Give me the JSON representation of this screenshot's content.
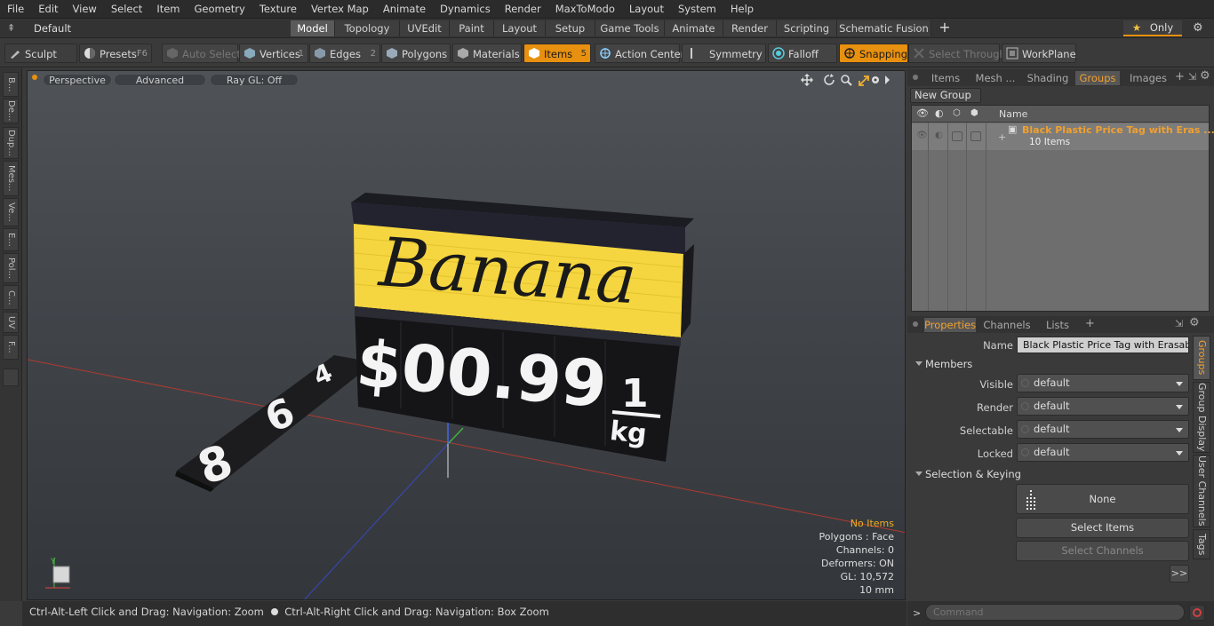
{
  "menu": [
    "File",
    "Edit",
    "View",
    "Select",
    "Item",
    "Geometry",
    "Texture",
    "Vertex Map",
    "Animate",
    "Dynamics",
    "Render",
    "MaxToModo",
    "Layout",
    "System",
    "Help"
  ],
  "layouts": {
    "current": "Default Layouts",
    "tabs": [
      "Model",
      "Topology",
      "UVEdit",
      "Paint",
      "Layout",
      "Setup",
      "Game Tools",
      "Animate",
      "Render",
      "Scripting",
      "Schematic Fusion"
    ],
    "active": "Model",
    "add": "+",
    "only_label": "Only",
    "star": "★"
  },
  "toolbar": {
    "sculpt": "Sculpt",
    "presets": "Presets",
    "presets_key": "F6",
    "auto_select": "Auto Select",
    "vertices": "Vertices",
    "vertices_count": "1",
    "edges": "Edges",
    "edges_count": "2",
    "polygons": "Polygons",
    "materials": "Materials",
    "items": "Items",
    "items_count": "5",
    "action_center": "Action Center",
    "symmetry": "Symmetry",
    "falloff": "Falloff",
    "snapping": "Snapping",
    "select_through": "Select Through",
    "workplane": "WorkPlane"
  },
  "left_tabs": [
    "B...",
    "De...",
    "Dup...",
    "Mes...",
    "Ve...",
    "E...",
    "Pol...",
    "C...",
    "UV",
    "F..."
  ],
  "viewport": {
    "perspective": "Perspective",
    "advanced": "Advanced",
    "raygl": "Ray GL: Off",
    "sign_title": "Banana",
    "sign_price": "$00.99",
    "sign_unit_top": "1",
    "sign_unit_bottom": "kg",
    "strip_digits": [
      "8",
      "6",
      "4"
    ],
    "info": {
      "no_items": "No Items",
      "polygons": "Polygons : Face",
      "channels": "Channels: 0",
      "deformers": "Deformers: ON",
      "gl": "GL: 10,572",
      "size": "10 mm"
    }
  },
  "status": {
    "left": "Ctrl-Alt-Left Click and Drag: Navigation: Zoom",
    "right": "Ctrl-Alt-Right Click and Drag: Navigation: Box Zoom"
  },
  "top_panel": {
    "tabs": [
      "Items",
      "Mesh ...",
      "Shading",
      "Groups",
      "Images"
    ],
    "active": "Groups",
    "new_group": "New Group",
    "col_name": "Name",
    "group_name": "Black Plastic Price Tag with Eras ...",
    "group_count": "10 Items"
  },
  "props_panel": {
    "tabs": [
      "Properties",
      "Channels",
      "Lists"
    ],
    "active": "Properties",
    "name_label": "Name",
    "name_value": "Black Plastic Price Tag with Erasable Di",
    "members": "Members",
    "fields": [
      {
        "label": "Visible",
        "value": "default"
      },
      {
        "label": "Render",
        "value": "default"
      },
      {
        "label": "Selectable",
        "value": "default"
      },
      {
        "label": "Locked",
        "value": "default"
      }
    ],
    "selection_keying": "Selection & Keying",
    "none": "None",
    "select_items": "Select Items",
    "select_channels": "Select Channels",
    "more": ">>",
    "side_tabs": [
      "Groups",
      "Group Display",
      "User Channels",
      "Tags"
    ]
  },
  "command": {
    "prompt": ">",
    "placeholder": "Command"
  },
  "colors": {
    "accent": "#e8900f",
    "sign_yellow": "#f5d640",
    "group_text": "#f0a030"
  }
}
